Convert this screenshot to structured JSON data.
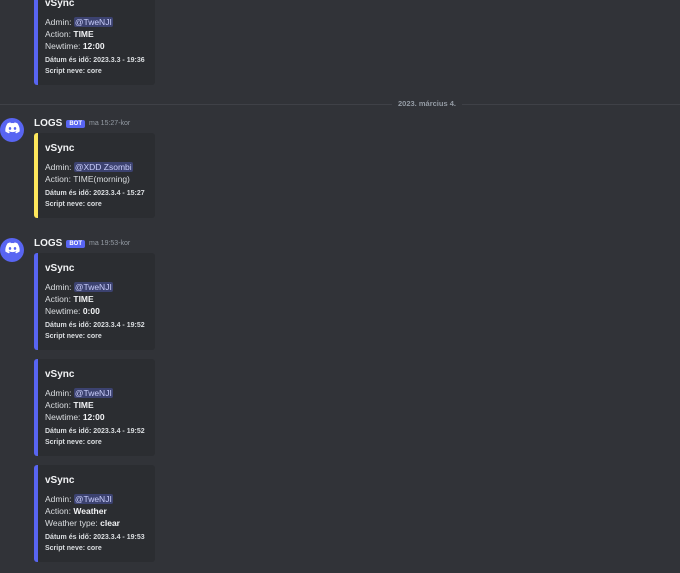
{
  "date_divider": "2023. március 4.",
  "messages": [
    {
      "author": "LOGS",
      "badge": "BOT",
      "time": ""
    },
    {
      "author": "LOGS",
      "badge": "BOT",
      "time": "ma 15:27-kor"
    },
    {
      "author": "LOGS",
      "badge": "BOT",
      "time": "ma 19:53-kor"
    }
  ],
  "embeds": [
    {
      "title": "vSync",
      "admin_label": "Admin:",
      "admin": "@TweNJI",
      "action_label": "Action:",
      "action": "TIME",
      "extra_label": "Newtime:",
      "extra": "12:00",
      "date_line": "Dátum és idő: 2023.3.3 - 19:36",
      "script_line": "Script neve: core",
      "color": "#5865f2"
    },
    {
      "title": "vSync",
      "admin_label": "Admin:",
      "admin": "@XDD Zsombi",
      "action_label": "Action:",
      "action": "TIME(morning)",
      "date_line": "Dátum és idő: 2023.3.4 - 15:27",
      "script_line": "Script neve: core",
      "color": "#fee75c"
    },
    {
      "title": "vSync",
      "admin_label": "Admin:",
      "admin": "@TweNJI",
      "action_label": "Action:",
      "action": "TIME",
      "extra_label": "Newtime:",
      "extra": "0:00",
      "date_line": "Dátum és idő: 2023.3.4 - 19:52",
      "script_line": "Script neve: core",
      "color": "#5865f2"
    },
    {
      "title": "vSync",
      "admin_label": "Admin:",
      "admin": "@TweNJI",
      "action_label": "Action:",
      "action": "TIME",
      "extra_label": "Newtime:",
      "extra": "12:00",
      "date_line": "Dátum és idő: 2023.3.4 - 19:52",
      "script_line": "Script neve: core",
      "color": "#5865f2"
    },
    {
      "title": "vSync",
      "admin_label": "Admin:",
      "admin": "@TweNJI",
      "action_label": "Action:",
      "action": "Weather",
      "extra_label": "Weather type:",
      "extra": "clear",
      "date_line": "Dátum és idő: 2023.3.4 - 19:53",
      "script_line": "Script neve: core",
      "color": "#5865f2"
    }
  ]
}
